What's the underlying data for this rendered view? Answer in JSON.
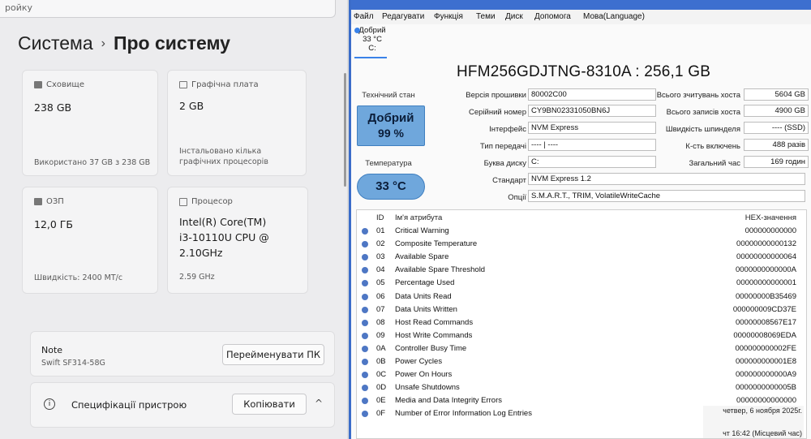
{
  "settings": {
    "search_text": "ройку",
    "breadcrumb_parent": "Система",
    "breadcrumb_sep": "›",
    "breadcrumb_current": "Про систему",
    "cards": {
      "storage": {
        "label": "Сховище",
        "value": "238 GB",
        "sub": "Використано 37 GB з 238 GB"
      },
      "gpu": {
        "label": "Графічна плата",
        "value": "2 GB",
        "sub1": "Інстальовано кілька",
        "sub2": "графічних процесорів"
      },
      "ram": {
        "label": "ОЗП",
        "value": "12,0 ГБ",
        "sub": "Швидкість: 2400 MT/с"
      },
      "cpu": {
        "label": "Процесор",
        "value1": "Intel(R) Core(TM)",
        "value2": "i3-10110U CPU @",
        "value3": "2.10GHz",
        "sub": "2.59 GHz"
      }
    },
    "device": {
      "title": "Note",
      "model": "Swift SF314-58G",
      "rename_button": "Перейменувати ПК"
    },
    "specs": {
      "title": "Специфікації пристрою",
      "copy_button": "Копіювати",
      "chevron": "^"
    }
  },
  "cdi": {
    "menu": [
      "Файл",
      "Редагувати",
      "Функція",
      "Теми",
      "Диск",
      "Допомога",
      "Мова(Language)"
    ],
    "disk_tab": {
      "status": "Добрий",
      "temp": "33 °C",
      "letter": "C:"
    },
    "model": "HFM256GDJTNG-8310A : 256,1 GB",
    "health_label": "Технічний стан",
    "health_status": "Добрий",
    "health_percent": "99 %",
    "temp_label": "Температура",
    "temp_value": "33 °C",
    "fields": {
      "firmware": {
        "label": "Версія прошивки",
        "value": "80002C00"
      },
      "serial": {
        "label": "Серійний номер",
        "value": "CY9BN02331050BN6J"
      },
      "interface": {
        "label": "Інтерфейс",
        "value": "NVM Express"
      },
      "transfer": {
        "label": "Тип передачі",
        "value": "---- | ----"
      },
      "letter": {
        "label": "Буква диску",
        "value": "C:"
      },
      "standard": {
        "label": "Стандарт",
        "value": "NVM Express 1.2"
      },
      "features": {
        "label": "Опції",
        "value": "S.M.A.R.T., TRIM, VolatileWriteCache"
      },
      "host_reads": {
        "label": "Всього зчитувань хоста",
        "value": "5604 GB"
      },
      "host_writes": {
        "label": "Всього записів хоста",
        "value": "4900 GB"
      },
      "rotation": {
        "label": "Швидкість шпинделя",
        "value": "---- (SSD)"
      },
      "power_count": {
        "label": "К-сть включень",
        "value": "488 разів"
      },
      "power_hours": {
        "label": "Загальний час",
        "value": "169 годин"
      }
    },
    "smart_headers": {
      "id": "ID",
      "name": "Ім'я атрибута",
      "raw": "HEX-значення"
    },
    "smart_rows": [
      {
        "id": "01",
        "name": "Critical Warning",
        "raw": "000000000000"
      },
      {
        "id": "02",
        "name": "Composite Temperature",
        "raw": "00000000000132"
      },
      {
        "id": "03",
        "name": "Available Spare",
        "raw": "00000000000064"
      },
      {
        "id": "04",
        "name": "Available Spare Threshold",
        "raw": "0000000000000A"
      },
      {
        "id": "05",
        "name": "Percentage Used",
        "raw": "00000000000001"
      },
      {
        "id": "06",
        "name": "Data Units Read",
        "raw": "00000000B35469"
      },
      {
        "id": "07",
        "name": "Data Units Written",
        "raw": "000000009CD37E"
      },
      {
        "id": "08",
        "name": "Host Read Commands",
        "raw": "00000008567E17"
      },
      {
        "id": "09",
        "name": "Host Write Commands",
        "raw": "00000008069EDA"
      },
      {
        "id": "0A",
        "name": "Controller Busy Time",
        "raw": "000000000002FE"
      },
      {
        "id": "0B",
        "name": "Power Cycles",
        "raw": "000000000001E8"
      },
      {
        "id": "0C",
        "name": "Power On Hours",
        "raw": "000000000000A9"
      },
      {
        "id": "0D",
        "name": "Unsafe Shutdowns",
        "raw": "0000000000005B"
      },
      {
        "id": "0E",
        "name": "Media and Data Integrity Errors",
        "raw": "00000000000000"
      },
      {
        "id": "0F",
        "name": "Number of Error Information Log Entries",
        "raw": ""
      }
    ],
    "datetime_line1": "четвер, 6 ноября 2025г.",
    "datetime_line2": "чт 16:42 (Місцевий час)"
  }
}
